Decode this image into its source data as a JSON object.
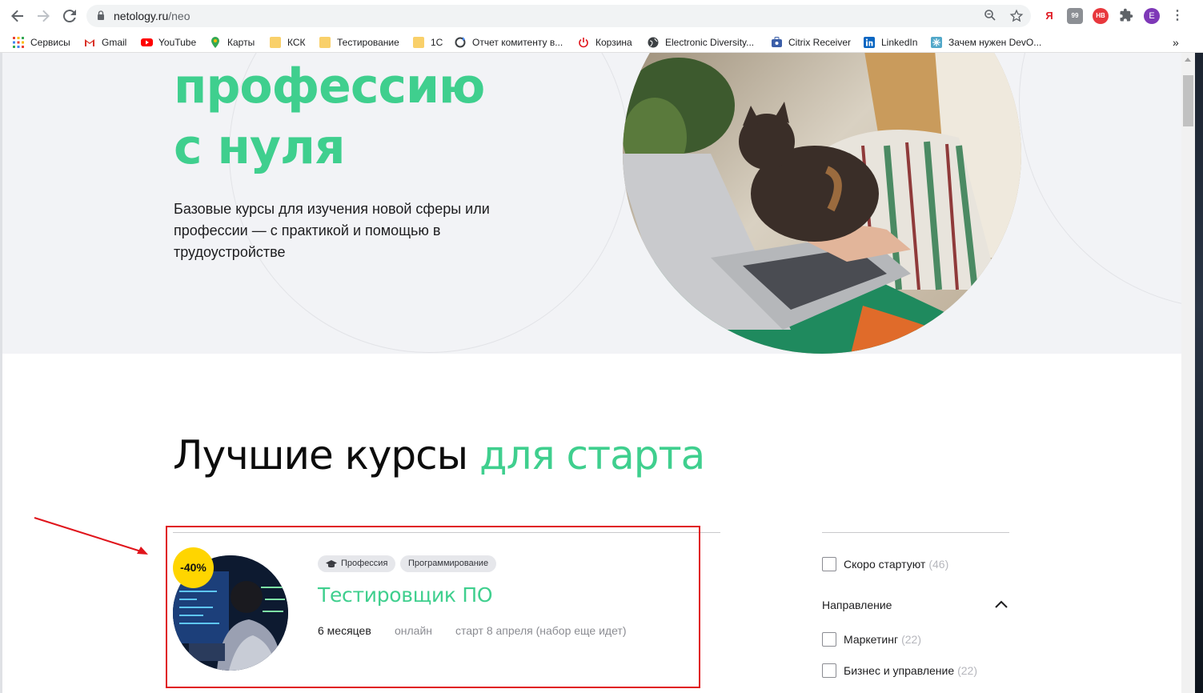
{
  "browser": {
    "url_host": "netology.ru",
    "url_path": "/neo",
    "profile_initial": "E",
    "bookmarks": [
      "Сервисы",
      "Gmail",
      "YouTube",
      "Карты",
      "КСК",
      "Тестирование",
      "1С",
      "Отчет комитенту в...",
      "Корзина",
      "Electronic Diversity...",
      "Citrix Receiver",
      "LinkedIn",
      "Зачем нужен DevO..."
    ],
    "bookmarks_overflow": "»"
  },
  "hero": {
    "title_line1": "профессию",
    "title_line2": "с нуля",
    "description": "Базовые курсы для изучения новой сферы или профессии — с практикой и помощью в трудоустройстве"
  },
  "section": {
    "title_main": "Лучшие курсы",
    "title_accent": "для старта"
  },
  "course": {
    "discount": "-40%",
    "tags": [
      "Профессия",
      "Программирование"
    ],
    "title": "Тестировщик ПО",
    "duration": "6 месяцев",
    "format": "онлайн",
    "start": "старт 8 апреля (набор еще идет)"
  },
  "filters": {
    "soon_label": "Скоро стартуют",
    "soon_count": "(46)",
    "direction_heading": "Направление",
    "items": [
      {
        "label": "Маркетинг",
        "count": "(22)"
      },
      {
        "label": "Бизнес и управление",
        "count": "(22)"
      }
    ]
  },
  "colors": {
    "accent_green": "#3fcf8e",
    "badge_yellow": "#ffd500",
    "annotation_red": "#e0141b"
  }
}
